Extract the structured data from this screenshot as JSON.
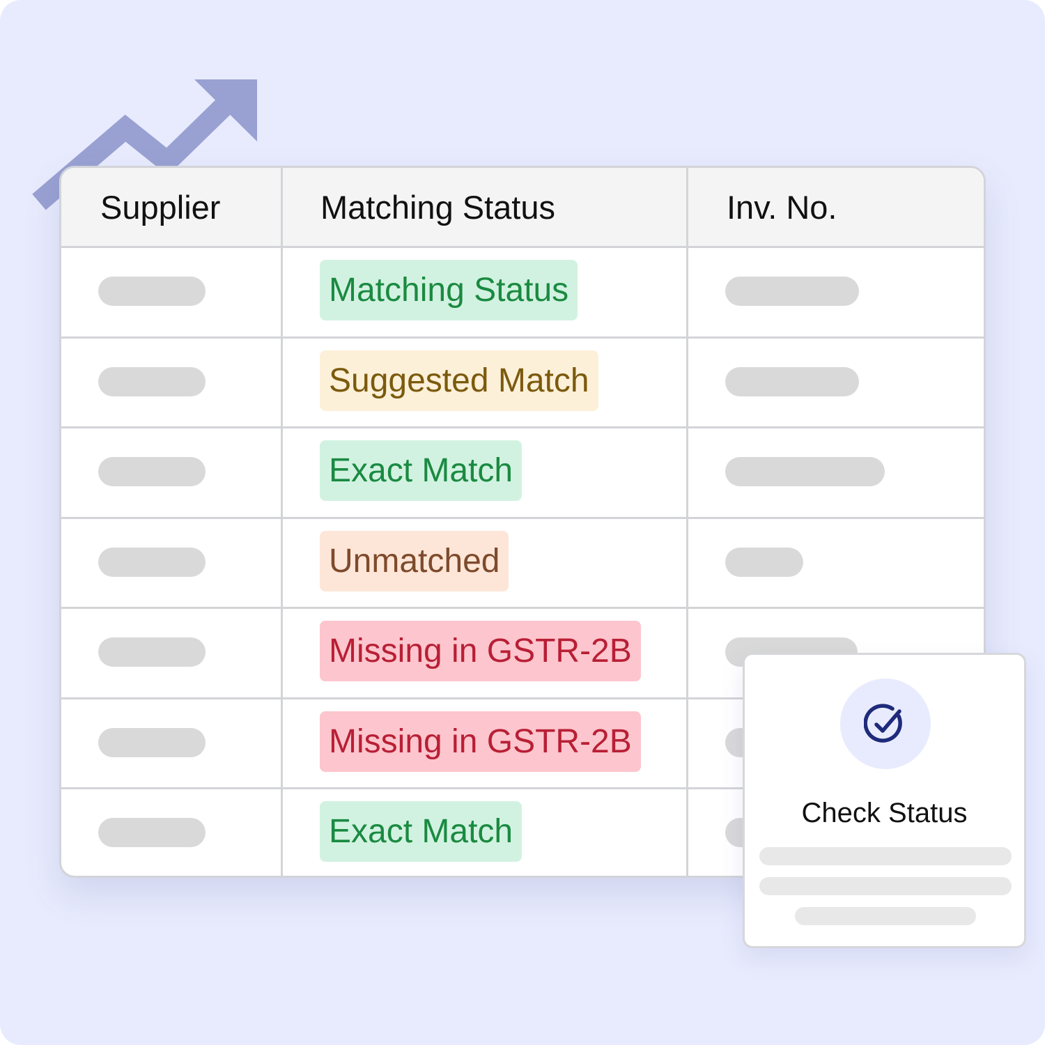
{
  "colors": {
    "background": "#e8ebfd",
    "arrow": "#99a1d2",
    "skeleton": "#d9d9d9",
    "exact_match_bg": "#d2f2e1",
    "exact_match_text": "#1a8a41",
    "suggested_match_bg": "#fdf0d9",
    "suggested_match_text": "#7b5a0d",
    "unmatched_bg": "#fde6d8",
    "unmatched_text": "#7d4a2b",
    "missing_bg": "#fdc5cd",
    "missing_text": "#b81f35",
    "check_icon": "#1e2a7a"
  },
  "decorations": {
    "trend_arrow_icon": "trend-up-arrow-icon"
  },
  "table": {
    "headers": {
      "supplier": "Supplier",
      "matching_status": "Matching Status",
      "inv_no": "Inv. No."
    },
    "rows": [
      {
        "status": "Matching Status",
        "tone": "green"
      },
      {
        "status": "Suggested Match",
        "tone": "yellow"
      },
      {
        "status": "Exact Match",
        "tone": "green"
      },
      {
        "status": "Unmatched",
        "tone": "peach"
      },
      {
        "status": "Missing in GSTR-2B",
        "tone": "red"
      },
      {
        "status": "Missing in GSTR-2B",
        "tone": "red"
      },
      {
        "status": "Exact Match",
        "tone": "green"
      }
    ]
  },
  "status_card": {
    "icon": "check-circle-icon",
    "label": "Check Status"
  }
}
